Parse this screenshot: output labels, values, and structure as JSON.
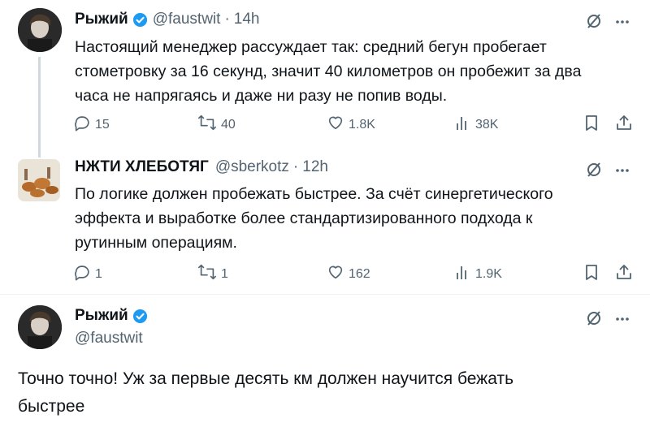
{
  "tweets": [
    {
      "name": "Рыжий",
      "handle": "@faustwit",
      "sep": "·",
      "time": "14h",
      "lines": [
        "Настоящий менеджер рассуждает так: средний бегун пробегает",
        "стометровку за 16 секунд, значит 40 километров он пробежит за два",
        "часа не напрягаясь и даже ни разу не попив воды."
      ],
      "replies": "15",
      "retweets": "40",
      "likes": "1.8K",
      "views": "38K"
    },
    {
      "name": "НЖТИ ХЛЕБОТЯГ",
      "handle": "@sberkotz",
      "sep": "·",
      "time": "12h",
      "lines": [
        "По логике должен пробежать быстрее. За счёт синергетического",
        "эффекта и выработке более стандартизированного подхода к",
        "рутинным операциям."
      ],
      "replies": "1",
      "retweets": "1",
      "likes": "162",
      "views": "1.9K"
    },
    {
      "name": "Рыжий",
      "handle": "@faustwit",
      "lines": [
        "Точно точно! Уж за первые десять км должен научится бежать",
        "быстрее"
      ]
    }
  ],
  "colors": {
    "verified": "#1d9bf0",
    "muted": "#536471",
    "line": "#cfd9de"
  },
  "icons": [
    "verified-badge-icon",
    "grok-icon",
    "more-icon",
    "reply-icon",
    "retweet-icon",
    "like-icon",
    "views-icon",
    "bookmark-icon",
    "share-icon"
  ]
}
